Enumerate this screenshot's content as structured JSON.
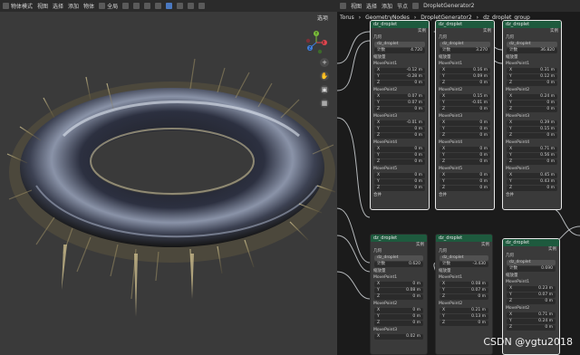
{
  "viewport": {
    "header": {
      "mode": "物体模式",
      "menus": [
        "视图",
        "选择",
        "添加",
        "物体"
      ],
      "transform": "全局"
    },
    "options_label": "选项",
    "gizmo": {
      "x": "X",
      "y": "Y",
      "z": "Z"
    },
    "tools": [
      "zoom-icon",
      "hand-icon",
      "camera-icon",
      "grid-icon"
    ]
  },
  "editor": {
    "header": {
      "menus": [
        "视图",
        "选择",
        "添加",
        "节点"
      ],
      "tree": "DropletGenerator2"
    },
    "breadcrumb": [
      "Torus",
      "GeometryNodes",
      "DropletGenerator2",
      "dz_droplet_group"
    ]
  },
  "node_fields": {
    "title": "dz_droplet",
    "out": "实例",
    "in": "几何",
    "group_input": "dz_droplet",
    "count": "计数",
    "scale": "缩放量",
    "mp1": "MovePoint1",
    "mp2": "MovePoint2",
    "mp3": "MovePoint3",
    "mp4": "MovePoint4",
    "mp5": "MovePoint5",
    "merge": "合并",
    "x": "X",
    "y": "Y",
    "z": "Z"
  },
  "nodes": [
    {
      "title": "dz_droplet",
      "count": "4.720",
      "mp1": [
        "-0.12 m",
        "-0.28 m",
        "0 m"
      ],
      "mp2": [
        "0.07 m",
        "0.07 m",
        "0 m"
      ],
      "mp3": [
        "-0.01 m",
        "0 m",
        "0 m"
      ],
      "mp4": [
        "0 m",
        "0 m",
        "0 m"
      ],
      "mp5": [
        "0 m",
        "0 m",
        "0 m"
      ]
    },
    {
      "title": "dz_droplet",
      "count": "3.270",
      "mp1": [
        "0.16 m",
        "0.09 m",
        "0 m"
      ],
      "mp2": [
        "0.15 m",
        "-0.01 m",
        "0 m"
      ],
      "mp3": [
        "0 m",
        "0 m",
        "0 m"
      ],
      "mp4": [
        "0 m",
        "0 m",
        "0 m"
      ],
      "mp5": [
        "0 m",
        "0 m",
        "0 m"
      ]
    },
    {
      "title": "dz_droplet",
      "count": "36.820",
      "mp1": [
        "0.31 m",
        "0.12 m",
        "0 m"
      ],
      "mp2": [
        "0.24 m",
        "0 m",
        "0 m"
      ],
      "mp3": [
        "0.39 m",
        "0.15 m",
        "0 m"
      ],
      "mp4": [
        "0.71 m",
        "0.56 m",
        "0 m"
      ],
      "mp5": [
        "0.45 m",
        "0.43 m",
        "0 m"
      ]
    },
    {
      "title": "dz_droplet",
      "count": "0.620",
      "mp1": [
        "0 m",
        "0.08 m",
        "0 m"
      ],
      "mp2": [
        "0 m",
        "0 m",
        "0 m"
      ],
      "mp3": [
        "0.02 m",
        "0 m",
        "0 m"
      ]
    },
    {
      "title": "dz_droplet",
      "count": "-3.430",
      "mp1": [
        "0.08 m",
        "0.07 m",
        "0 m"
      ],
      "mp2": [
        "0.21 m",
        "0.13 m",
        "0 m"
      ]
    },
    {
      "title": "dz_droplet",
      "count": "0.690",
      "mp1": [
        "0.23 m",
        "0.07 m",
        "0 m"
      ],
      "mp2": [
        "0.71 m",
        "0.24 m",
        "0 m"
      ]
    }
  ],
  "watermark": "CSDN @ygtu2018"
}
